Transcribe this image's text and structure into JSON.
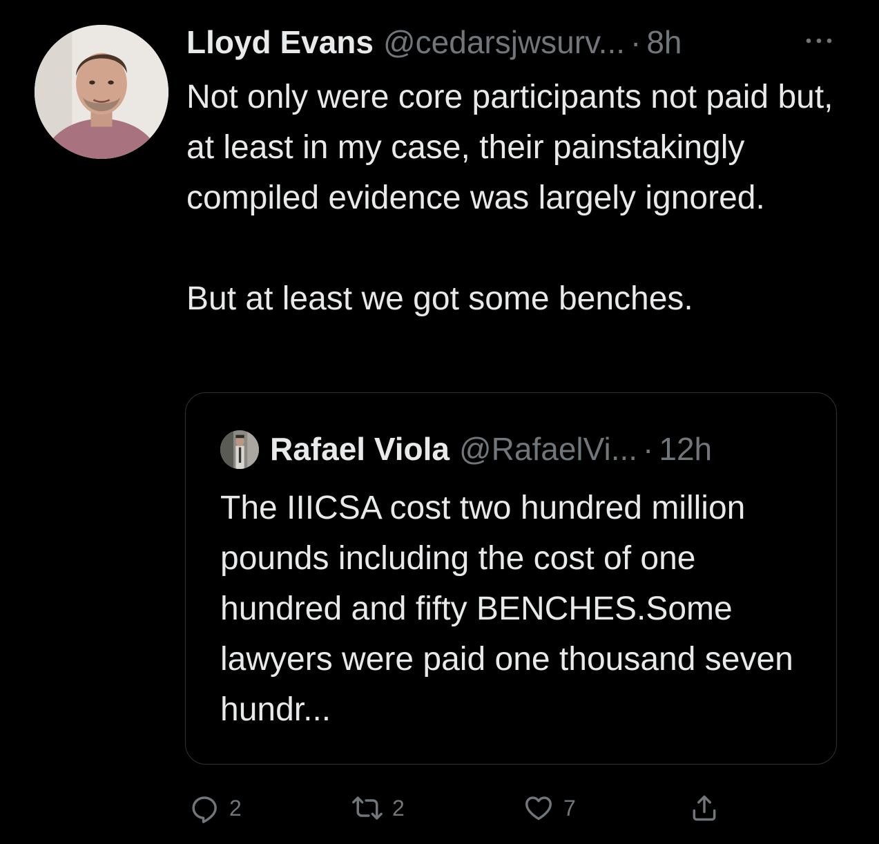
{
  "tweet": {
    "author_name": "Lloyd Evans",
    "author_handle": "@cedarsjwsurv...",
    "separator": "·",
    "time": "8h",
    "text_paragraphs": [
      "Not only were core participants not paid but, at least in my case, their painstakingly compiled evidence was largely ignored.",
      "But at least we got some benches."
    ],
    "more_icon": "more-horizontal-icon"
  },
  "quoted_tweet": {
    "author_name": "Rafael Viola",
    "author_handle": "@RafaelVi...",
    "separator": "·",
    "time": "12h",
    "text": "The IIICSA cost two hundred million pounds including the cost of one hundred and fifty BENCHES.Some lawyers were paid one thousand seven hundr..."
  },
  "actions": {
    "reply": {
      "icon": "reply-icon",
      "count": "2"
    },
    "retweet": {
      "icon": "retweet-icon",
      "count": "2"
    },
    "like": {
      "icon": "heart-icon",
      "count": "7"
    },
    "share": {
      "icon": "share-icon"
    }
  },
  "colors": {
    "background": "#000000",
    "primary_text": "#e7e9ea",
    "secondary_text": "#71767b",
    "border": "#2f3336"
  }
}
